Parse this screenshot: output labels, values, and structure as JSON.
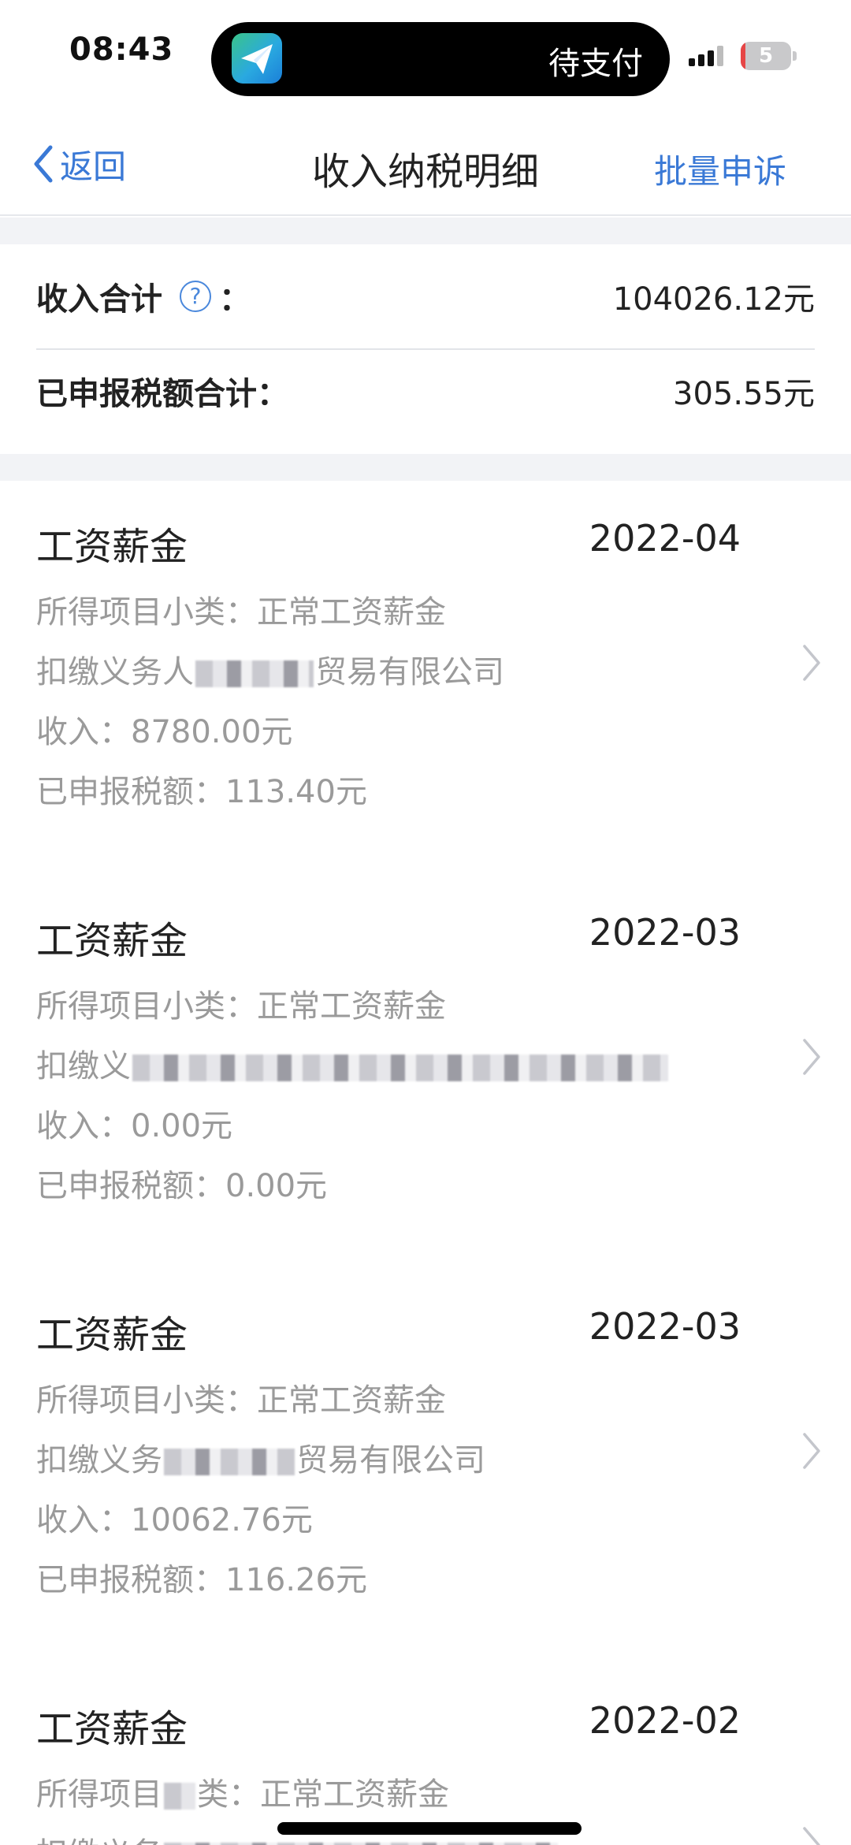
{
  "status_bar": {
    "time": "08:43",
    "island_label": "待支付",
    "battery_level": "5",
    "island_icon": "paper-plane-icon"
  },
  "nav": {
    "back_label": "返回",
    "title": "收入纳税明细",
    "action_label": "批量申诉"
  },
  "summary": {
    "income_total_label": "收入合计",
    "colon": "：",
    "income_total_value": "104026.12元",
    "tax_total_label": "已申报税额合计：",
    "tax_total_value": "305.55元"
  },
  "records": [
    {
      "type": "工资薪金",
      "month": "2022-04",
      "subtype_label": "所得项目小类：",
      "subtype_value": "正常工资薪金",
      "payer_prefix": "扣缴义务人",
      "payer_suffix": "贸易有限公司",
      "income": "收入：8780.00元",
      "tax": "已申报税额：113.40元"
    },
    {
      "type": "工资薪金",
      "month": "2022-03",
      "subtype_label": "所得项目小类：",
      "subtype_value": "正常工资薪金",
      "payer_prefix": "扣缴义",
      "payer_suffix": "",
      "income": "收入：0.00元",
      "tax": "已申报税额：0.00元"
    },
    {
      "type": "工资薪金",
      "month": "2022-03",
      "subtype_label": "所得项目小类：",
      "subtype_value": "正常工资薪金",
      "payer_prefix": "扣缴义务",
      "payer_suffix": "贸易有限公司",
      "income": "收入：10062.76元",
      "tax": "已申报税额：116.26元"
    },
    {
      "type": "工资薪金",
      "month": "2022-02",
      "subtype_label": "所得项目",
      "subtype_value": "类：正常工资薪金",
      "payer_prefix": "扣缴义务",
      "payer_suffix": "",
      "income": "",
      "tax": ""
    }
  ],
  "colors": {
    "accent": "#3a79d6",
    "text_primary": "#222222",
    "text_secondary": "#9a9a9a",
    "band": "#f2f3f6"
  }
}
